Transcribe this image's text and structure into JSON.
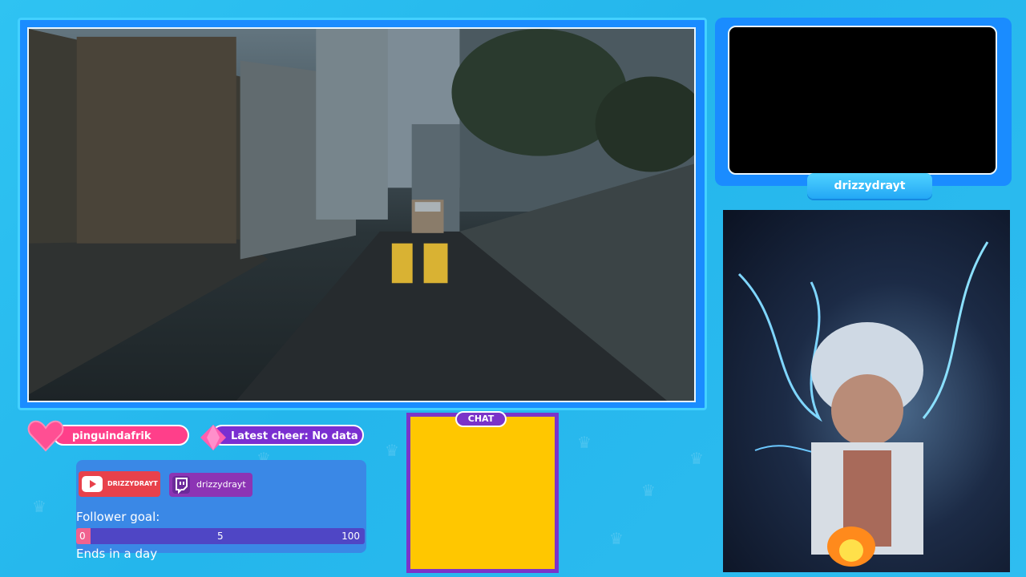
{
  "camera": {
    "username": "drizzydrayt"
  },
  "alerts": {
    "latest_follower": "pinguindafrik",
    "latest_cheer": "Latest cheer: No data"
  },
  "socials": {
    "youtube": "DRIZZYDRAYT",
    "twitch": "drizzydrayt"
  },
  "goal": {
    "label": "Follower goal:",
    "current_label": "0",
    "midpoint_label": "5",
    "target_label": "100",
    "progress": 0.05,
    "ends": "Ends in a day"
  },
  "chat": {
    "title": "CHAT"
  },
  "colors": {
    "background": "#2fc3f2",
    "frame": "#1a8cff",
    "follower_pill": "#ff3f8a",
    "cheer_pill": "#7a2fd1",
    "chat_fill": "#ffc700",
    "chat_border": "#7b34c9"
  },
  "icons": [
    "heart-icon",
    "diamond-icon",
    "youtube-icon",
    "twitch-icon",
    "crown-icon"
  ]
}
